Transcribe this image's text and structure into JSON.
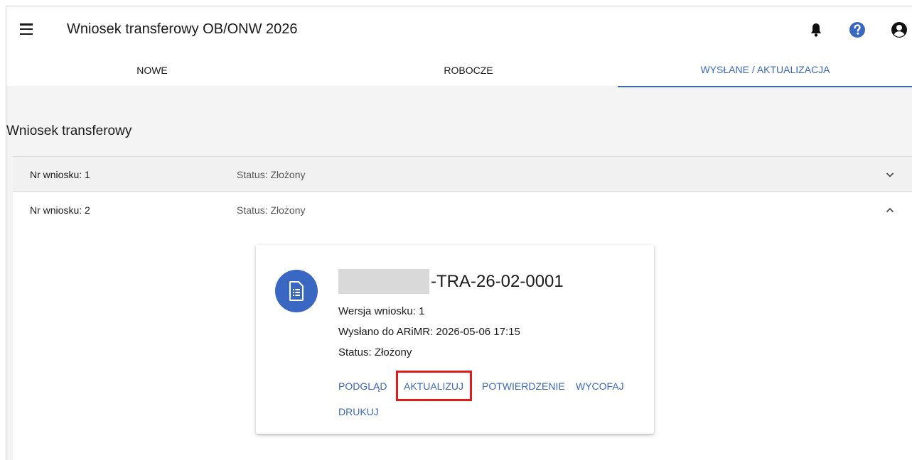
{
  "header": {
    "title": "Wniosek transferowy OB/ONW 2026",
    "icons": [
      "menu-icon",
      "bell-icon",
      "help-icon",
      "account-icon"
    ]
  },
  "tabs": [
    {
      "label": "NOWE",
      "active": false
    },
    {
      "label": "ROBOCZE",
      "active": false
    },
    {
      "label": "WYSŁANE / AKTUALIZACJA",
      "active": true
    }
  ],
  "section": {
    "title": "Wniosek transferowy"
  },
  "applications": [
    {
      "nr_label": "Nr wniosku: 1",
      "status_label": "Status: Złożony",
      "expanded": false
    },
    {
      "nr_label": "Nr wniosku: 2",
      "status_label": "Status: Złożony",
      "expanded": true
    }
  ],
  "card": {
    "number_suffix": "-TRA-26-02-0001",
    "version": "Wersja wniosku: 1",
    "sent": "Wysłano do ARiMR: 2026-05-06 17:15",
    "status": "Status: Złożony",
    "actions": [
      "PODGLĄD",
      "AKTUALIZUJ",
      "POTWIERDZENIE",
      "WYCOFAJ",
      "DRUKUJ"
    ],
    "highlighted_action": "AKTUALIZUJ"
  },
  "colors": {
    "accent": "#3a67c2",
    "highlight": "#e01b1b"
  }
}
